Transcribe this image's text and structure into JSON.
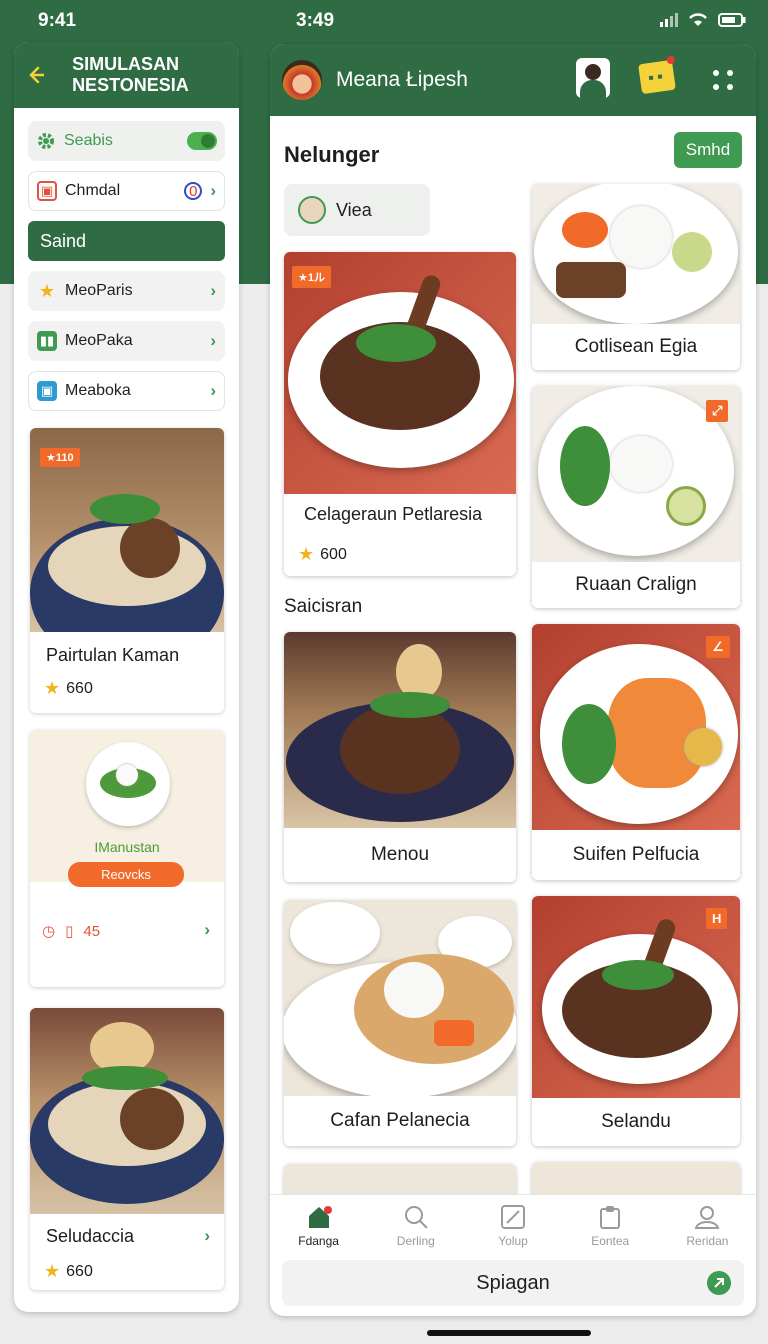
{
  "status": {
    "time_left": "9:41",
    "time_right": "3:49"
  },
  "left_panel": {
    "title": "SIMULASAN NESTONESIA",
    "toggle_label": "Seabis",
    "menu": [
      {
        "label": "Chmdal",
        "icon": "image-icon"
      },
      {
        "label": "Saind",
        "icon": ""
      },
      {
        "label": "MeoParis",
        "icon": "star-icon"
      },
      {
        "label": "MeoPaka",
        "icon": "grid-icon"
      },
      {
        "label": "Meaboka",
        "icon": "image-icon"
      }
    ],
    "cards": [
      {
        "badge": "★110",
        "title": "Pairtulan Kaman",
        "rating": "660"
      },
      {
        "promo_title": "IManustan",
        "promo_button": "Reovcks",
        "meta": "45"
      },
      {
        "title": "Seludaccia",
        "rating": "660"
      }
    ]
  },
  "right_panel": {
    "title": "Meana Łipesh",
    "section_title": "Nelunger",
    "send_button": "Smhd",
    "filter_chip": "Viea",
    "subsection": "Saicisran",
    "cards": [
      {
        "title": "Celageraun Petlaresia",
        "rating": "600",
        "badge": "★1ル"
      },
      {
        "title": "Cotlisean Egia"
      },
      {
        "title": "Ruaan Cralign"
      },
      {
        "title": "Menou"
      },
      {
        "title": "Suifen Pelfucia"
      },
      {
        "title": "Cafan Pelanecia"
      },
      {
        "title": "Selandu"
      }
    ],
    "nav": [
      {
        "label": "Fdanga",
        "icon": "home-icon"
      },
      {
        "label": "Derling",
        "icon": "search-icon"
      },
      {
        "label": "Yolup",
        "icon": "edit-icon"
      },
      {
        "label": "Eontea",
        "icon": "clipboard-icon"
      },
      {
        "label": "Reridan",
        "icon": "profile-icon"
      }
    ],
    "bottom_button": "Spiagan"
  },
  "colors": {
    "primary": "#2f6b43",
    "accent": "#f26a2a",
    "star": "#f2b418"
  }
}
